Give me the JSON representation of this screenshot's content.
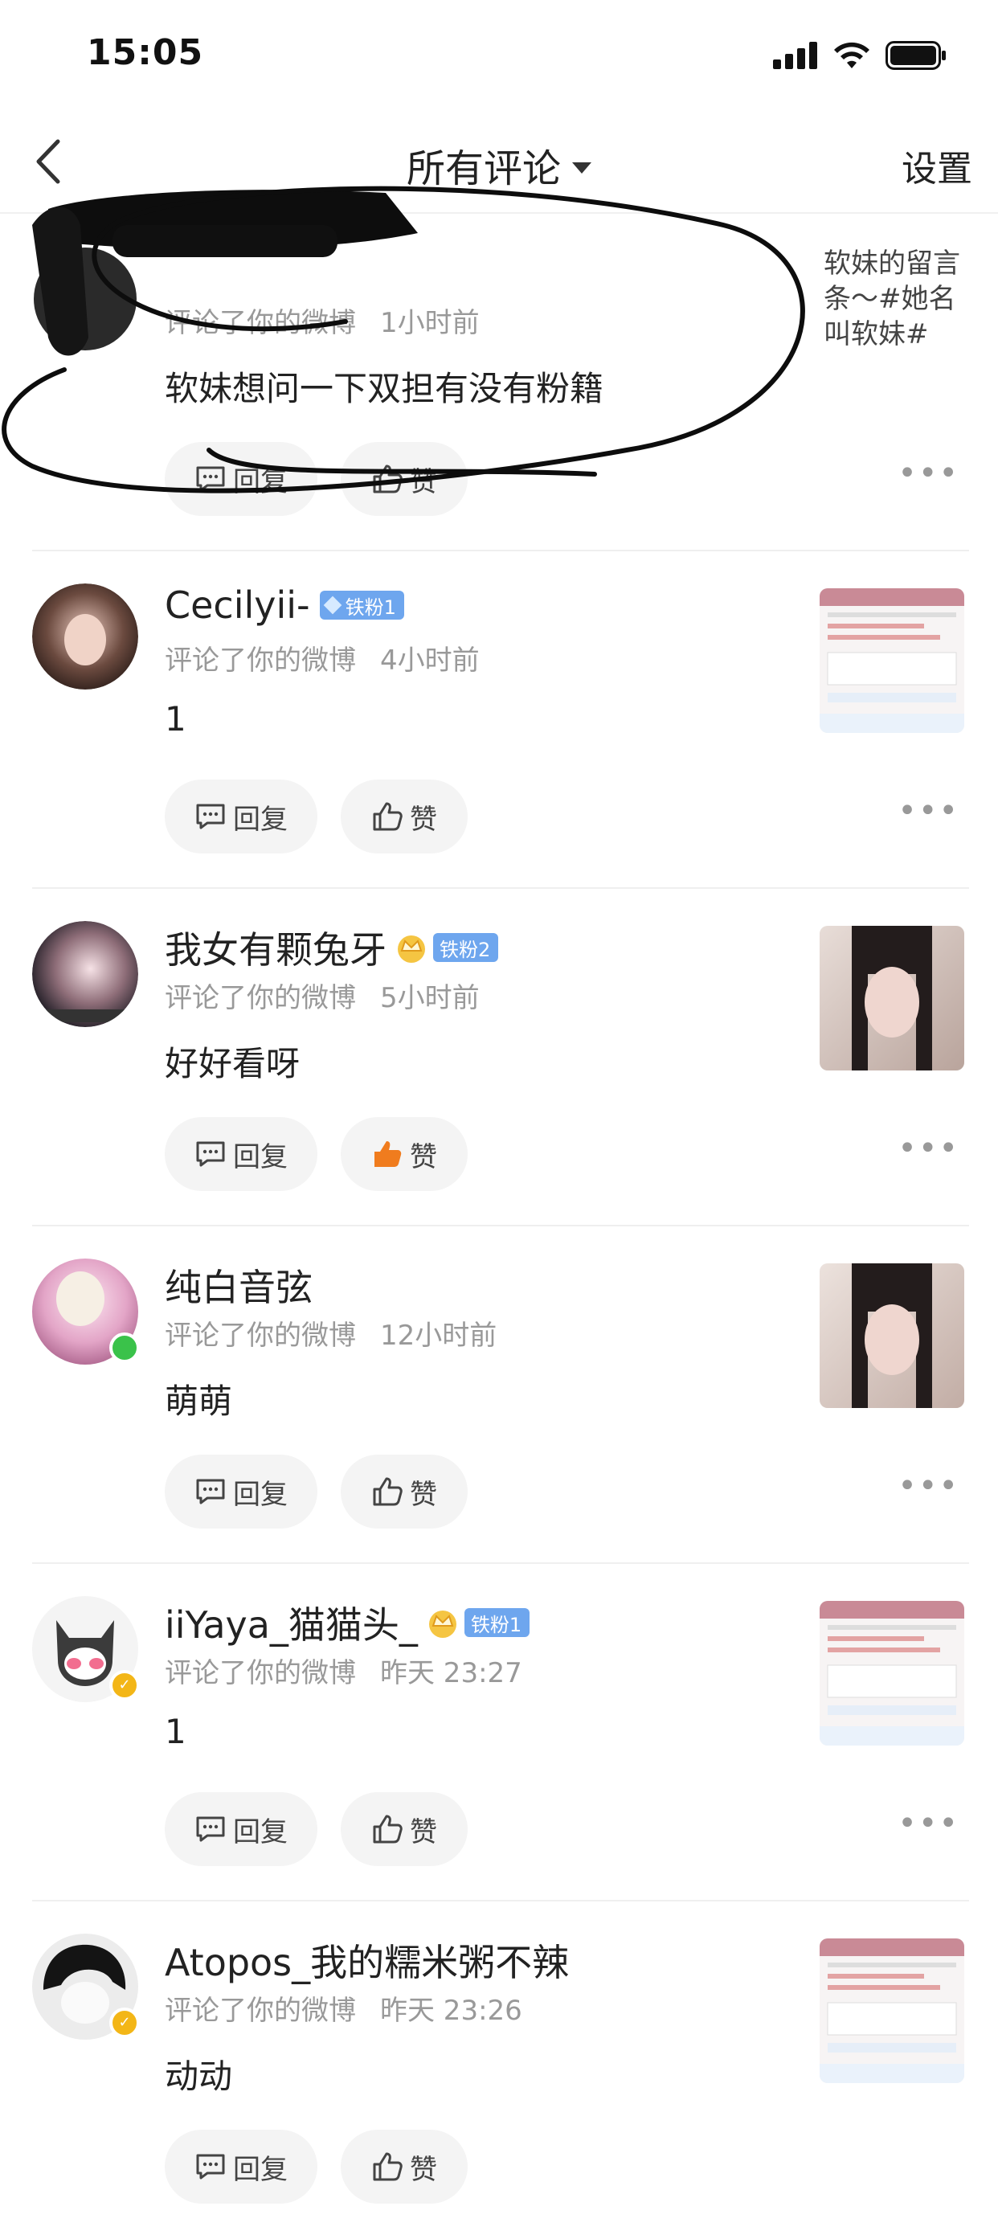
{
  "status_bar": {
    "time": "15:05"
  },
  "nav": {
    "title": "所有评论",
    "settings": "设置"
  },
  "actions": {
    "reply": "回复",
    "like": "赞"
  },
  "comments": [
    {
      "username": "",
      "action": "评论了你的微博",
      "time": "1小时前",
      "text": "软妹想问一下双担有没有粉籍",
      "thumb_text": "软妹的留言条～#她名叫软妹#",
      "avatar_status": "online",
      "liked": false
    },
    {
      "username": "Cecilyii-",
      "badge": "铁粉1",
      "action": "评论了你的微博",
      "time": "4小时前",
      "text": "1",
      "liked": false
    },
    {
      "username": "我女有颗兔牙",
      "badge": "铁粉2",
      "action": "评论了你的微博",
      "time": "5小时前",
      "text": "好好看呀",
      "liked": true
    },
    {
      "username": "纯白音弦",
      "action": "评论了你的微博",
      "time": "12小时前",
      "text": "萌萌",
      "avatar_status": "online",
      "liked": false
    },
    {
      "username": "iiYaya_猫猫头_",
      "badge": "铁粉1",
      "action": "评论了你的微博",
      "time": "昨天 23:27",
      "text": "1",
      "avatar_status": "verified",
      "liked": false
    },
    {
      "username": "Atopos_我的糯米粥不辣",
      "action": "评论了你的微博",
      "time": "昨天 23:26",
      "text": "动动",
      "avatar_status": "verified",
      "liked": false
    }
  ],
  "colors": {
    "accent_like": "#f07c1e",
    "badge": "#6ea6ee",
    "meta": "#999999"
  }
}
